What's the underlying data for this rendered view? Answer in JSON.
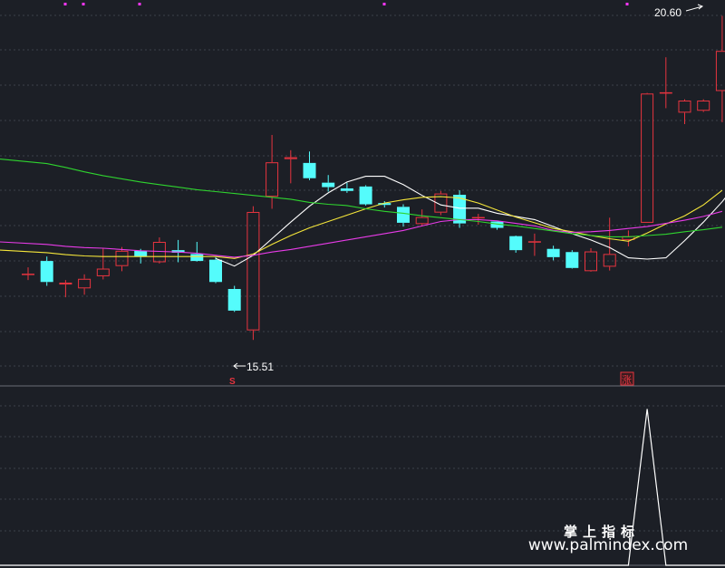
{
  "chart_data": {
    "type": "candlestick",
    "title": "",
    "xlabel": "",
    "ylabel": "",
    "grid": true,
    "legend": "none",
    "price_axis": {
      "ylim": [
        15.2,
        20.75
      ]
    },
    "annotations": {
      "high_label": "20.60",
      "low_label": "15.51",
      "limit_up_tag": "涨",
      "signal_marker": "S"
    },
    "colors": {
      "background": "#1c1f26",
      "up": "#e8343f",
      "down": "#54fcfc",
      "ma_white": "#ffffff",
      "ma_yellow": "#f5e63a",
      "ma_magenta": "#e83be8",
      "ma_green": "#2fd42f",
      "indicator": "#ffffff",
      "grid": "#3d404a",
      "top_dots": "#ff36ff"
    },
    "candles": [
      {
        "o": 16.55,
        "h": 16.65,
        "l": 16.45,
        "c": 16.55
      },
      {
        "o": 16.75,
        "h": 16.82,
        "l": 16.36,
        "c": 16.42
      },
      {
        "o": 16.38,
        "h": 16.45,
        "l": 16.18,
        "c": 16.41
      },
      {
        "o": 16.32,
        "h": 16.54,
        "l": 16.22,
        "c": 16.47
      },
      {
        "o": 16.51,
        "h": 16.95,
        "l": 16.46,
        "c": 16.63
      },
      {
        "o": 16.67,
        "h": 16.97,
        "l": 16.59,
        "c": 16.91
      },
      {
        "o": 16.91,
        "h": 16.94,
        "l": 16.71,
        "c": 16.82
      },
      {
        "o": 16.73,
        "h": 17.12,
        "l": 16.71,
        "c": 17.05
      },
      {
        "o": 16.92,
        "h": 17.08,
        "l": 16.73,
        "c": 16.88
      },
      {
        "o": 16.86,
        "h": 17.05,
        "l": 16.74,
        "c": 16.75
      },
      {
        "o": 16.77,
        "h": 16.81,
        "l": 16.4,
        "c": 16.42
      },
      {
        "o": 16.31,
        "h": 16.36,
        "l": 15.95,
        "c": 15.97
      },
      {
        "o": 15.66,
        "h": 17.61,
        "l": 15.51,
        "c": 17.52
      },
      {
        "o": 17.76,
        "h": 18.73,
        "l": 17.57,
        "c": 18.3
      },
      {
        "o": 18.35,
        "h": 18.49,
        "l": 17.97,
        "c": 18.38
      },
      {
        "o": 18.29,
        "h": 18.47,
        "l": 18.02,
        "c": 18.05
      },
      {
        "o": 17.98,
        "h": 18.1,
        "l": 17.84,
        "c": 17.91
      },
      {
        "o": 17.89,
        "h": 17.98,
        "l": 17.82,
        "c": 17.85
      },
      {
        "o": 17.92,
        "h": 17.94,
        "l": 17.62,
        "c": 17.64
      },
      {
        "o": 17.66,
        "h": 17.69,
        "l": 17.59,
        "c": 17.63
      },
      {
        "o": 17.6,
        "h": 17.64,
        "l": 17.29,
        "c": 17.35
      },
      {
        "o": 17.33,
        "h": 17.56,
        "l": 17.3,
        "c": 17.44
      },
      {
        "o": 17.51,
        "h": 17.85,
        "l": 17.47,
        "c": 17.81
      },
      {
        "o": 17.79,
        "h": 17.86,
        "l": 17.27,
        "c": 17.34
      },
      {
        "o": 17.43,
        "h": 17.49,
        "l": 17.32,
        "c": 17.44
      },
      {
        "o": 17.37,
        "h": 17.37,
        "l": 17.24,
        "c": 17.27
      },
      {
        "o": 17.14,
        "h": 17.15,
        "l": 16.88,
        "c": 16.92
      },
      {
        "o": 17.06,
        "h": 17.18,
        "l": 16.83,
        "c": 17.06
      },
      {
        "o": 16.94,
        "h": 16.99,
        "l": 16.76,
        "c": 16.81
      },
      {
        "o": 16.89,
        "h": 16.92,
        "l": 16.63,
        "c": 16.64
      },
      {
        "o": 16.59,
        "h": 16.95,
        "l": 16.58,
        "c": 16.9
      },
      {
        "o": 16.66,
        "h": 17.43,
        "l": 16.6,
        "c": 16.86
      },
      {
        "o": 17.08,
        "h": 17.23,
        "l": 16.98,
        "c": 17.14
      },
      {
        "o": 17.35,
        "h": 19.39,
        "l": 17.35,
        "c": 19.38
      },
      {
        "o": 19.4,
        "h": 19.95,
        "l": 19.15,
        "c": 19.4
      },
      {
        "o": 19.08,
        "h": 19.29,
        "l": 18.9,
        "c": 19.27
      },
      {
        "o": 19.11,
        "h": 19.29,
        "l": 19.09,
        "c": 19.27
      },
      {
        "o": 19.42,
        "h": 20.6,
        "l": 18.93,
        "c": 20.05
      }
    ],
    "moving_averages": [
      {
        "color": "ma_white",
        "start": 10,
        "values": [
          16.79,
          16.67,
          16.84,
          17.1,
          17.36,
          17.61,
          17.82,
          17.99,
          18.08,
          18.08,
          17.95,
          17.78,
          17.63,
          17.58,
          17.58,
          17.5,
          17.45,
          17.4,
          17.29,
          17.18,
          17.08,
          16.96,
          16.8,
          16.78,
          16.8,
          17.07,
          17.36,
          17.68,
          18.05,
          18.51,
          18.85,
          19.28
        ]
      },
      {
        "color": "ma_yellow",
        "start": 0,
        "values": [
          16.92,
          16.88,
          16.85,
          16.83,
          16.82,
          16.82,
          16.82,
          16.82,
          16.82,
          16.82,
          16.82,
          16.79,
          16.86,
          17.01,
          17.15,
          17.27,
          17.37,
          17.47,
          17.57,
          17.66,
          17.71,
          17.75,
          17.76,
          17.74,
          17.66,
          17.55,
          17.44,
          17.35,
          17.26,
          17.21,
          17.15,
          17.1,
          17.06,
          17.19,
          17.33,
          17.46,
          17.63,
          17.86
        ]
      },
      {
        "color": "ma_magenta",
        "start": 0,
        "values": [
          17.05,
          17.01,
          16.98,
          16.96,
          16.95,
          16.93,
          16.91,
          16.9,
          16.89,
          16.87,
          16.84,
          16.81,
          16.84,
          16.89,
          16.93,
          16.98,
          17.03,
          17.08,
          17.13,
          17.18,
          17.23,
          17.3,
          17.37,
          17.4,
          17.4,
          17.38,
          17.34,
          17.3,
          17.23,
          17.2,
          17.21,
          17.23,
          17.26,
          17.29,
          17.34,
          17.39,
          17.45,
          17.53
        ]
      },
      {
        "color": "ma_green",
        "start": 0,
        "values": [
          18.35,
          18.28,
          18.22,
          18.15,
          18.09,
          18.04,
          17.99,
          17.95,
          17.91,
          17.87,
          17.84,
          17.81,
          17.78,
          17.75,
          17.72,
          17.67,
          17.64,
          17.62,
          17.57,
          17.53,
          17.5,
          17.46,
          17.43,
          17.4,
          17.37,
          17.33,
          17.3,
          17.26,
          17.22,
          17.18,
          17.15,
          17.13,
          17.13,
          17.15,
          17.17,
          17.21,
          17.24,
          17.28
        ]
      }
    ],
    "indicator": {
      "ylim": [
        0,
        1
      ],
      "start": 31,
      "values": [
        0,
        0,
        0.98,
        0,
        0
      ]
    }
  },
  "watermark": {
    "caption_cn": "掌上指标",
    "caption_url": "www.palmindex.com"
  }
}
